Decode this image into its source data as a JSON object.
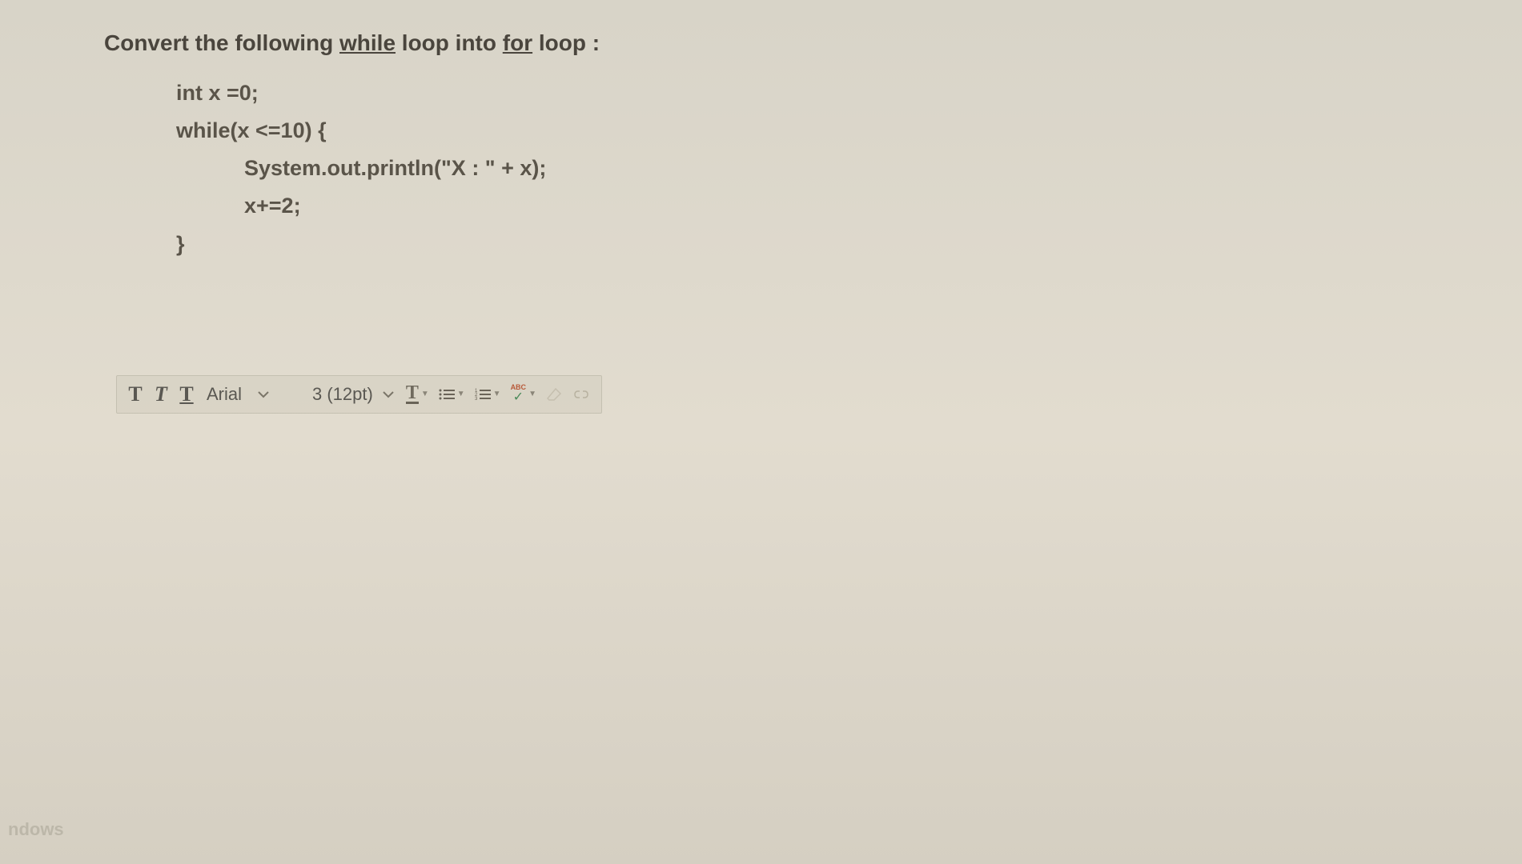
{
  "question": {
    "prefix": "Convert the following ",
    "word1": "while",
    "middle": " loop into ",
    "word2": "for",
    "suffix": " loop :"
  },
  "code": {
    "line1": "int x =0;",
    "line2": "while(x <=10) {",
    "line3": "System.out.println(\"X : \" + x);",
    "line4": "x+=2;",
    "line5": "}"
  },
  "toolbar": {
    "bold": "T",
    "italic": "T",
    "underline": "T",
    "font_family": "Arial",
    "font_size": "3 (12pt)",
    "text_color": "T",
    "spellcheck_abc": "ABC"
  },
  "watermark": "ndows"
}
